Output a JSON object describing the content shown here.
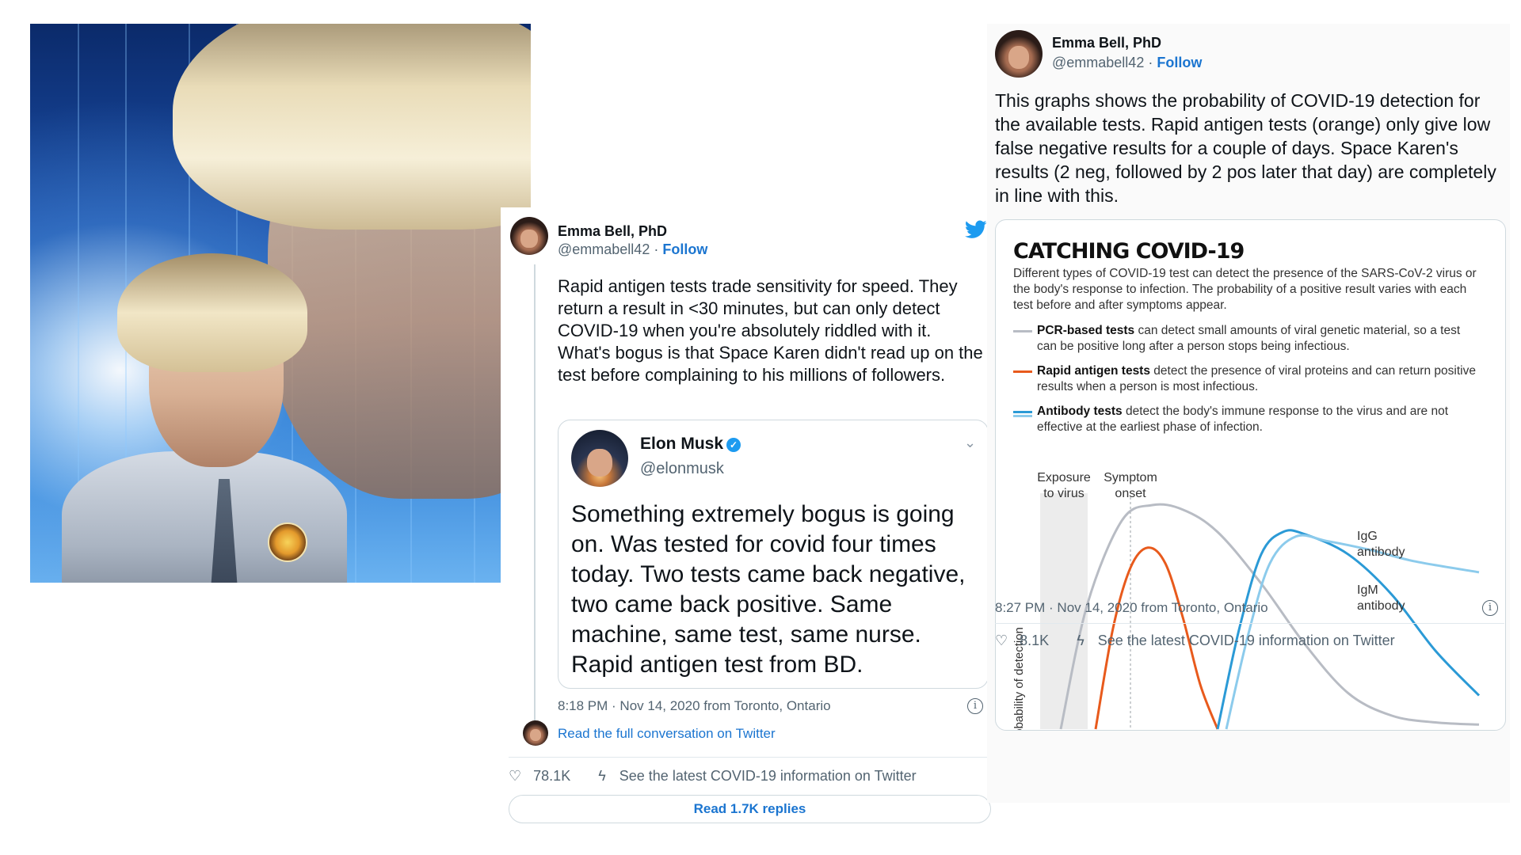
{
  "tweet_mid": {
    "author_name": "Emma Bell, PhD",
    "author_handle": "@emmabell42",
    "separator": "·",
    "follow_label": "Follow",
    "text": "Rapid antigen tests trade sensitivity for speed. They return a result in <30 minutes, but can only detect COVID-19 when you're absolutely riddled with it. What's bogus is that Space Karen didn't read up on the test before complaining to his millions of followers.",
    "quoted": {
      "author_name": "Elon Musk",
      "author_handle": "@elonmusk",
      "text": "Something extremely bogus is going on. Was tested for covid four times today. Two tests came back negative, two came back positive. Same machine, same test, same nurse. Rapid antigen test from BD."
    },
    "timestamp": "8:18 PM · Nov 14, 2020 from Toronto, Ontario",
    "conversation_link": "Read the full conversation on Twitter",
    "like_count": "78.1K",
    "covid_info": "See the latest COVID-19 information on Twitter",
    "read_replies": "Read 1.7K replies",
    "twitter_color": "#1d9bf0"
  },
  "tweet_right": {
    "author_name": "Emma Bell, PhD",
    "author_handle": "@emmabell42",
    "separator": "·",
    "follow_label": "Follow",
    "text": "This graphs shows the probability of COVID-19 detection for the available tests. Rapid antigen tests (orange) only give low false negative results for a couple of days. Space Karen's results (2 neg, followed by 2 pos later that day) are completely in line with this.",
    "timestamp": "8:27 PM · Nov 14, 2020 from Toronto, Ontario",
    "like_count": "8.1K",
    "covid_info": "See the latest COVID-19 information on Twitter"
  },
  "chart_data": {
    "type": "line",
    "title": "CATCHING COVID-19",
    "description": "Different types of COVID-19 test can detect the presence of the SARS-CoV-2 virus or the body's response to infection. The probability of a positive result varies with each test before and after symptoms appear.",
    "legend": [
      {
        "bold": "PCR-based tests",
        "text": " can detect small amounts of viral genetic material, so a test can be positive long after a person stops being infectious.",
        "color": "#b8bcc4"
      },
      {
        "bold": "Rapid antigen tests",
        "text": " detect the presence of viral proteins and can return positive results when a person is most infectious.",
        "color": "#e85a1c"
      },
      {
        "bold": "Antibody tests",
        "text": " detect the body's immune response to the virus and are not effective at the earliest phase of infection.",
        "color": "#2b9ad6"
      }
    ],
    "ylabel": "Probability of detection",
    "markers": {
      "exposure": "Exposure to virus",
      "symptom": "Symptom onset"
    },
    "xlim": [
      0,
      100
    ],
    "ylim": [
      0,
      1
    ],
    "series": [
      {
        "name": "PCR-based tests",
        "color": "#b8bcc4",
        "x": [
          4,
          10,
          18,
          25,
          32,
          40,
          50,
          60,
          70,
          80,
          90,
          100
        ],
        "y": [
          0,
          0.55,
          0.93,
          1.0,
          0.98,
          0.88,
          0.65,
          0.38,
          0.16,
          0.06,
          0.03,
          0.02
        ]
      },
      {
        "name": "Rapid antigen tests",
        "color": "#e85a1c",
        "x": [
          12,
          16,
          20,
          24,
          28,
          32,
          36,
          40
        ],
        "y": [
          0,
          0.45,
          0.72,
          0.81,
          0.74,
          0.5,
          0.2,
          0
        ]
      },
      {
        "name": "IgM antibody",
        "color": "#2b9ad6",
        "x": [
          40,
          45,
          50,
          55,
          60,
          70,
          80,
          90,
          100
        ],
        "y": [
          0,
          0.45,
          0.78,
          0.88,
          0.87,
          0.78,
          0.6,
          0.35,
          0.15
        ]
      },
      {
        "name": "IgG antibody",
        "color": "#8ccbec",
        "x": [
          42,
          47,
          52,
          58,
          65,
          75,
          85,
          100
        ],
        "y": [
          0,
          0.42,
          0.74,
          0.86,
          0.84,
          0.8,
          0.75,
          0.7
        ]
      }
    ],
    "curve_labels": {
      "igg": "IgG antibody",
      "igm": "IgM antibody"
    },
    "grid": false
  }
}
